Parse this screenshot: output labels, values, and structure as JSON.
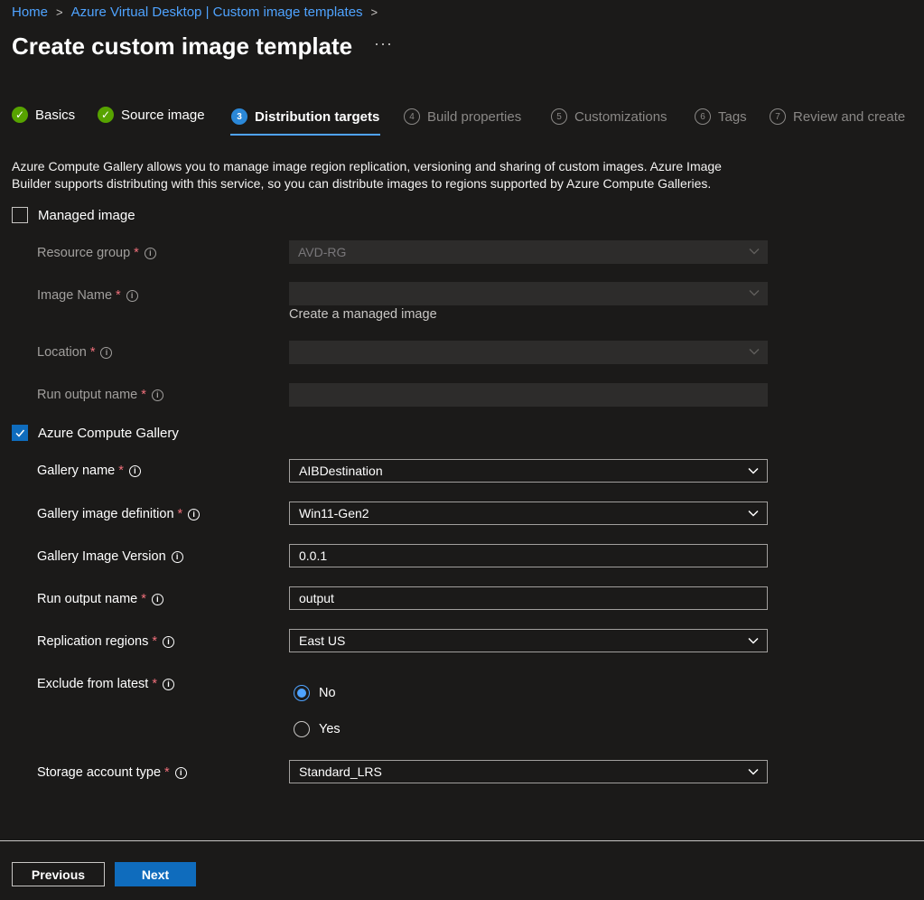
{
  "breadcrumb": {
    "home": "Home",
    "parent": "Azure Virtual Desktop | Custom image templates"
  },
  "page": {
    "title": "Create custom image template",
    "more": "···"
  },
  "steps": [
    {
      "label": "Basics",
      "number": "✓"
    },
    {
      "label": "Source image",
      "number": "✓"
    },
    {
      "label": "Distribution targets",
      "number": "3"
    },
    {
      "label": "Build properties",
      "number": "4"
    },
    {
      "label": "Customizations",
      "number": "5"
    },
    {
      "label": "Tags",
      "number": "6"
    },
    {
      "label": "Review and create",
      "number": "7"
    }
  ],
  "description": "Azure Compute Gallery allows you to manage image region replication, versioning and sharing of custom images. Azure Image Builder supports distributing with this service, so you can distribute images to regions supported by Azure Compute Galleries.",
  "managed_image": {
    "checkbox_label": "Managed image",
    "checked": false,
    "resource_group": {
      "label": "Resource group",
      "value": "AVD-RG"
    },
    "image_name": {
      "label": "Image Name",
      "value": "",
      "hint": "Create a managed image"
    },
    "location": {
      "label": "Location",
      "value": ""
    },
    "run_output_name": {
      "label": "Run output name",
      "value": ""
    }
  },
  "compute_gallery": {
    "checkbox_label": "Azure Compute Gallery",
    "checked": true,
    "gallery_name": {
      "label": "Gallery name",
      "value": "AIBDestination"
    },
    "gallery_image_definition": {
      "label": "Gallery image definition",
      "value": "Win11-Gen2"
    },
    "gallery_image_version": {
      "label": "Gallery Image Version",
      "value": "0.0.1"
    },
    "run_output_name": {
      "label": "Run output name",
      "value": "output"
    },
    "replication_regions": {
      "label": "Replication regions",
      "value": "East US"
    },
    "exclude_from_latest": {
      "label": "Exclude from latest",
      "options": [
        "No",
        "Yes"
      ],
      "selected": "No"
    },
    "storage_account_type": {
      "label": "Storage account type",
      "value": "Standard_LRS"
    }
  },
  "common": {
    "required_mark": "*",
    "info_glyph": "i"
  },
  "footer": {
    "previous": "Previous",
    "next": "Next"
  },
  "colors": {
    "background": "#1b1a19",
    "accent": "#0f6cbd",
    "link": "#4fa3ff",
    "success": "#57a300"
  },
  "icons": {
    "chevron": "chevron-down-icon",
    "info": "info-icon",
    "check": "checkmark-icon"
  }
}
